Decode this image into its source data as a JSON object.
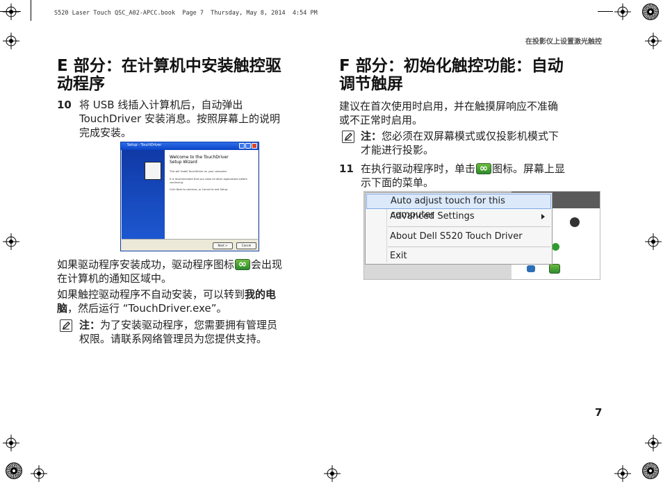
{
  "slug": "S520 Laser Touch QSC_A02-APCC.book  Page 7  Thursday, May 8, 2014  4:54 PM",
  "running_header": "在投影仪上设置激光触控",
  "page_number": "7",
  "left": {
    "heading": [
      "E 部分：在计算机中安装触控驱",
      "动程序"
    ],
    "step10": {
      "num": "10",
      "lines": [
        "将 USB 线插入计算机后，自动弹出",
        "TouchDriver 安装消息。按照屏幕上的说明",
        "完成安装。"
      ]
    },
    "wizard": {
      "title": "Setup - TouchDriver",
      "welcome": [
        "Welcome to the TouchDriver",
        "Setup Wizard"
      ],
      "text1": "This will install TouchDriver on your computer.",
      "text2": [
        "It is recommended that you close all other applications before",
        "continuing."
      ],
      "text3": "Click Next to continue, or Cancel to exit Setup.",
      "next": "Next >",
      "cancel": "Cancel"
    },
    "para1": {
      "before": "如果驱动程序安装成功，驱动程序图标",
      "after": "会出现",
      "line2": "在计算机的通知区域中。"
    },
    "para2": {
      "line1_before": "如果触控驱动程序不自动安装，可以转到",
      "bold": "我的电",
      "line2_bold": "脑",
      "line2_after": "，然后运行 “TouchDriver.exe”。"
    },
    "note": {
      "label": "注：",
      "line1": "为了安装驱动程序，您需要拥有管理员",
      "line2": "权限。请联系网络管理员为您提供支持。"
    }
  },
  "right": {
    "heading": [
      "F 部分：初始化触控功能：自动",
      "调节触屏"
    ],
    "intro": [
      "建议在首次使用时启用，并在触摸屏响应不准确",
      "或不正常时启用。"
    ],
    "note": {
      "label": "注：",
      "line1": "您必须在双屏幕模式或仅投影机模式下",
      "line2": "才能进行投影。"
    },
    "step11": {
      "num": "11",
      "before": "在执行驱动程序时，单击",
      "after": "图标。屏幕上显",
      "line2": "示下面的菜单。"
    },
    "menu": {
      "items": [
        {
          "label": "Auto adjust touch for this computer",
          "highlighted": true
        },
        {
          "label": "Advanced Settings",
          "submenu": true
        },
        {
          "label": "About Dell S520 Touch Driver"
        },
        {
          "label": "Exit"
        }
      ]
    }
  },
  "icons": {
    "note": "pencil-note-icon",
    "driver": "touch-driver-tray-icon"
  }
}
